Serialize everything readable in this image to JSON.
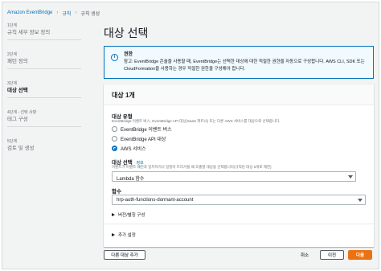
{
  "breadcrumb": [
    "Amazon EventBridge",
    "규칙",
    "규칙 생성"
  ],
  "steps": [
    {
      "num": "1단계",
      "name": "규칙 세부 정보 정의",
      "active": false
    },
    {
      "num": "2단계",
      "name": "패턴 정의",
      "active": false
    },
    {
      "num": "3단계",
      "name": "대상 선택",
      "active": true
    },
    {
      "num": "4단계 - 선택 사항",
      "name": "태그 구성",
      "active": false
    },
    {
      "num": "5단계",
      "name": "검토 및 생성",
      "active": false
    }
  ],
  "page_title": "대상 선택",
  "info": {
    "title": "권한",
    "body": "참고: EventBridge 콘솔을 사용할 때, EventBridge는 선택한 대상에 대한 적절한 권한을 자동으로 구성합니다. AWS CLI, SDK 또는 CloudFormation을 사용하는 경우 적절한 권한을 구성해야 합니다."
  },
  "target_panel": {
    "title": "대상 1개",
    "target_type_label": "대상 유형",
    "target_type_desc": "EventBridge 이벤트 버스, EventBridge API 대상(SaaS 파트너) 또는 다른 AWS 서비스를 대상으로 선택합니다.",
    "options": [
      "EventBridge 이벤트 버스",
      "EventBridge API 대상",
      "AWS 서비스"
    ],
    "select_target_label": "대상 선택",
    "select_target_label_info": "정보",
    "select_target_desc": "이벤트가 이벤트 패턴과 일치하거나 일정이 트리거될 때 호출할 대상을 선택합니다(규칙당 대상 5개로 제한)",
    "select_target_value": "Lambda 함수",
    "function_label": "함수",
    "function_value": "hrp-auth-functions-dormant-account",
    "version_alias": "버전/별칭 구성",
    "additional_settings": "추가 설정"
  },
  "footer": {
    "add_target": "다른 대상 추가",
    "cancel": "취소",
    "previous": "이전",
    "next": "다음"
  },
  "colors": {
    "accent": "#0073bb",
    "primary": "#ec7211"
  }
}
